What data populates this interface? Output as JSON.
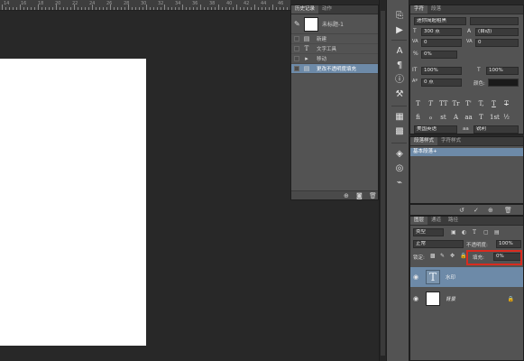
{
  "ruler": {
    "labels": [
      "14",
      "16",
      "18",
      "20",
      "22",
      "24",
      "26",
      "28",
      "30",
      "32",
      "34",
      "36",
      "38",
      "40",
      "42",
      "44",
      "46"
    ]
  },
  "history_panel": {
    "tabs": [
      "历史记录",
      "动作"
    ],
    "snapshot_name": "未标题-1",
    "items": [
      {
        "label": "新建",
        "icon": "document-icon"
      },
      {
        "label": "文字工具",
        "icon": "text-tool-icon"
      },
      {
        "label": "移动",
        "icon": "move-icon"
      },
      {
        "label": "更改不透明度填充",
        "icon": "document-icon",
        "selected": true
      }
    ]
  },
  "character_panel": {
    "tabs": [
      "字符",
      "段落"
    ],
    "font_family": "迷你简超粗黑",
    "font_size": "300 点",
    "leading": "(自动)",
    "kerning": "0",
    "tracking": "0",
    "scale_percent": "0%",
    "vertical_scale": "100%",
    "horizontal_scale": "100%",
    "baseline_shift": "0 点",
    "color_label": "颜色:",
    "language": "美国英语",
    "antialias": "锐利",
    "aa_label": "aa",
    "style_buttons": [
      "T",
      "T",
      "TT",
      "Tr",
      "T'",
      "T,",
      "T",
      "T"
    ],
    "opentype_buttons": [
      "fi",
      "ℴ",
      "st",
      "A",
      "aa",
      "T",
      "1st",
      "½"
    ]
  },
  "paragraph_style_panel": {
    "tabs": [
      "段落样式",
      "字符样式"
    ],
    "selected_item": "基本段落+"
  },
  "layers_panel": {
    "tabs": [
      "图层",
      "通道",
      "路径"
    ],
    "filter_type": "类型",
    "blend_mode": "正常",
    "opacity_label": "不透明度:",
    "opacity_value": "100%",
    "lock_label": "锁定:",
    "fill_label": "填充:",
    "fill_value": "0%",
    "layers": [
      {
        "name": "水印",
        "type": "text",
        "selected": true
      },
      {
        "name": "背景",
        "type": "image",
        "locked": true
      }
    ]
  },
  "colors": {
    "selection": "#6d8aa8",
    "panel": "#535353",
    "highlight": "#d92b1f"
  }
}
